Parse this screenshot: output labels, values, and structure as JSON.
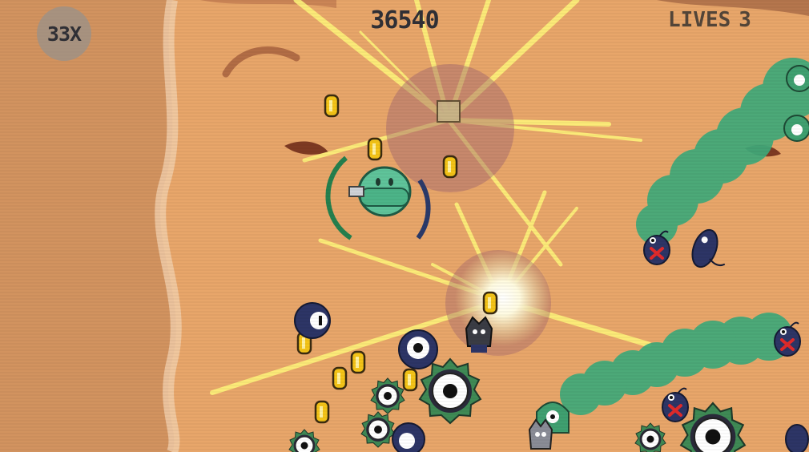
{
  "hud": {
    "multiplier": "33X",
    "score": "36540",
    "lives_label": "LIVES",
    "lives_value": "3"
  },
  "colors": {
    "sand": "#e8a66a",
    "cliff": "#d2915c",
    "slime_trail": "#3faa7a",
    "coin": "#f4c418",
    "ray": "#fff27a",
    "enemy_navy": "#2d3566",
    "x_mark": "#e02a2a",
    "shield_green": "#24804e",
    "shield_navy": "#2a3a6a"
  },
  "icons": [
    "coin-icon",
    "eyeball-enemy-icon",
    "spiked-eyeball-icon",
    "x-marked-bug-icon",
    "shield-arc-icon",
    "slime-player-icon"
  ]
}
